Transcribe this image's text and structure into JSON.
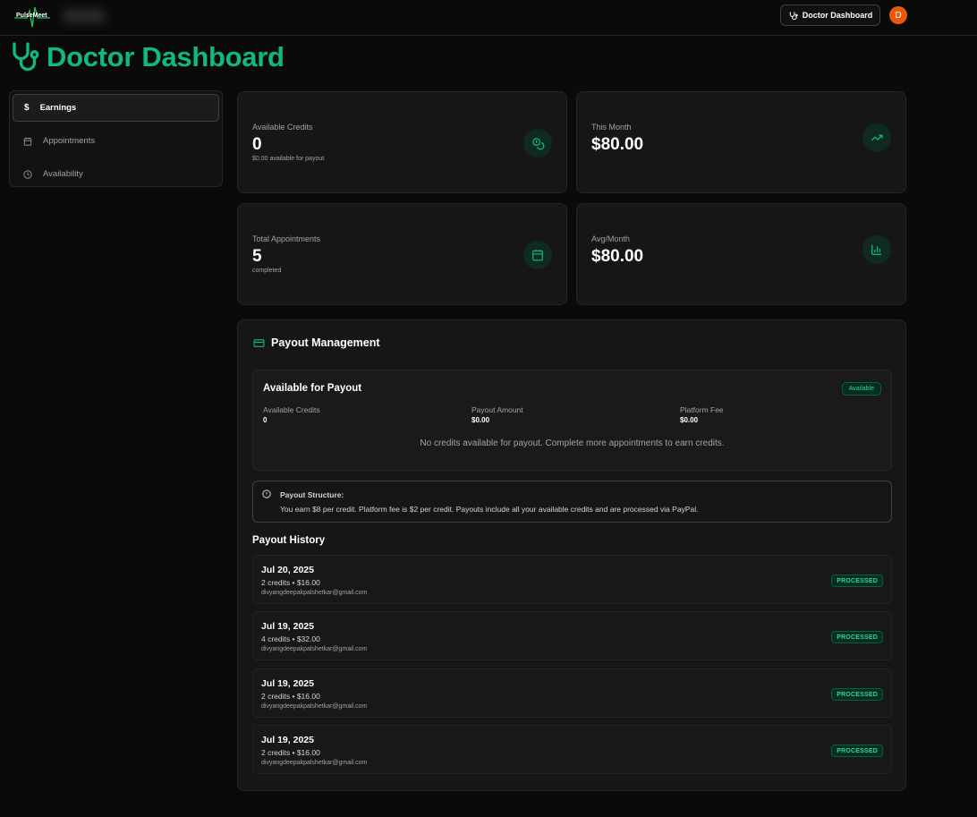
{
  "header": {
    "brand": "PulseMeet",
    "dashboard_button": "Doctor Dashboard",
    "avatar_initial": "D"
  },
  "page": {
    "title": "Doctor Dashboard"
  },
  "sidebar": {
    "items": [
      {
        "label": "Earnings",
        "icon": "dollar-icon",
        "active": true
      },
      {
        "label": "Appointments",
        "icon": "calendar-icon",
        "active": false
      },
      {
        "label": "Availability",
        "icon": "clock-icon",
        "active": false
      }
    ]
  },
  "stats": {
    "available_credits": {
      "label": "Available Credits",
      "value": "0",
      "sub": "$0.00 available for payout",
      "icon": "coins-icon"
    },
    "this_month": {
      "label": "This Month",
      "value": "$80.00",
      "icon": "trending-up-icon"
    },
    "total_appointments": {
      "label": "Total Appointments",
      "value": "5",
      "sub": "completed",
      "icon": "calendar-icon"
    },
    "avg_month": {
      "label": "Avg/Month",
      "value": "$80.00",
      "icon": "bar-chart-icon"
    }
  },
  "payout": {
    "title": "Payout Management",
    "available": {
      "title": "Available for Payout",
      "badge": "Available",
      "credits_label": "Available Credits",
      "credits_value": "0",
      "amount_label": "Payout Amount",
      "amount_value": "$0.00",
      "fee_label": "Platform Fee",
      "fee_value": "$0.00",
      "message": "No credits available for payout. Complete more appointments to earn credits."
    },
    "structure": {
      "title": "Payout Structure:",
      "text": "You earn $8 per credit. Platform fee is $2 per credit. Payouts include all your available credits and are processed via PayPal."
    },
    "history_title": "Payout History",
    "history": [
      {
        "date": "Jul 20, 2025",
        "credits": "2 credits • $16.00",
        "email": "divyangdeepakpalshetkar@gmail.com",
        "status": "PROCESSED"
      },
      {
        "date": "Jul 19, 2025",
        "credits": "4 credits • $32.00",
        "email": "divyangdeepakpalshetkar@gmail.com",
        "status": "PROCESSED"
      },
      {
        "date": "Jul 19, 2025",
        "credits": "2 credits • $16.00",
        "email": "divyangdeepakpalshetkar@gmail.com",
        "status": "PROCESSED"
      },
      {
        "date": "Jul 19, 2025",
        "credits": "2 credits • $16.00",
        "email": "divyangdeepakpalshetkar@gmail.com",
        "status": "PROCESSED"
      }
    ]
  },
  "colors": {
    "accent": "#10b981",
    "background": "#0a0a0a",
    "card": "#161616",
    "avatar": "#ea580c"
  }
}
